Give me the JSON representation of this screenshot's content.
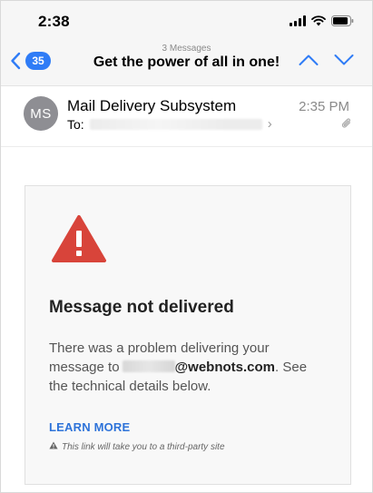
{
  "status_bar": {
    "time": "2:38"
  },
  "nav": {
    "unread_count": "35",
    "subtitle": "3 Messages",
    "title": "Get the power of all in one!",
    "accent_color": "#2f7cf6"
  },
  "email": {
    "avatar_initials": "MS",
    "sender": "Mail Delivery Subsystem",
    "time": "2:35 PM",
    "to_label": "To:"
  },
  "message": {
    "heading": "Message not delivered",
    "body_part1": "There was a problem delivering your message to",
    "body_domain": "@webnots.com",
    "body_part2": ". See the technical details below.",
    "learn_more": "LEARN MORE",
    "third_party_note": "This link will take you to a third-party site",
    "warning_color": "#d8443a"
  }
}
